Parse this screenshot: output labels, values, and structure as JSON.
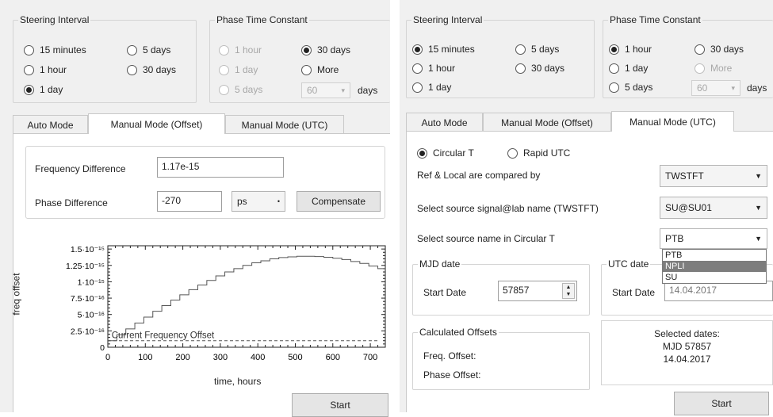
{
  "left": {
    "steering": {
      "legend": "Steering Interval",
      "options": [
        "15 minutes",
        "5 days",
        "1 hour",
        "30 days",
        "1 day"
      ],
      "selected": "1 day"
    },
    "phase": {
      "legend": "Phase Time Constant",
      "options": [
        "1 hour",
        "30 days",
        "1 day",
        "More",
        "5 days"
      ],
      "selected": "30 days",
      "more_value": "60",
      "more_unit": "days"
    },
    "tabs": [
      "Auto Mode",
      "Manual Mode (Offset)",
      "Manual Mode (UTC)"
    ],
    "active_tab": "Manual Mode (Offset)",
    "freq_label": "Frequency Difference",
    "freq_value": "1.17e-15",
    "phase_label": "Phase Difference",
    "phase_value": "-270",
    "phase_unit": "ps",
    "compensate_label": "Compensate",
    "start_label": "Start"
  },
  "chart_data": {
    "type": "line",
    "xlabel": "time, hours",
    "ylabel": "freq offset",
    "annotation": "Current Frequency Offset",
    "xlim": [
      0,
      740
    ],
    "ylim": [
      0,
      1.55e-15
    ],
    "x_ticks": [
      "0",
      "100",
      "200",
      "300",
      "400",
      "500",
      "600",
      "700"
    ],
    "x_tick_values": [
      0,
      100,
      200,
      300,
      400,
      500,
      600,
      700
    ],
    "y_ticks": [
      "0",
      "2.5·10⁻¹⁶",
      "5·10⁻¹⁶",
      "7.5·10⁻¹⁶",
      "1·10⁻¹⁵",
      "1.25·10⁻¹⁵",
      "1.5·10⁻¹⁵"
    ],
    "y_tick_values": [
      0,
      2.5e-16,
      5e-16,
      7.5e-16,
      1e-15,
      1.25e-15,
      1.5e-15
    ],
    "series": [
      {
        "style": "step",
        "x": [
          0,
          24,
          48,
          72,
          96,
          120,
          144,
          168,
          192,
          216,
          240,
          264,
          288,
          312,
          336,
          360,
          384,
          408,
          432,
          456,
          480,
          504,
          528,
          552,
          576,
          600,
          624,
          648,
          672,
          696,
          720
        ],
        "values": [
          1e-16,
          1.9e-16,
          2.8e-16,
          3.7e-16,
          4.6e-16,
          5.5e-16,
          6.35e-16,
          7.2e-16,
          8e-16,
          8.8e-16,
          9.5e-16,
          1.02e-15,
          1.09e-15,
          1.15e-15,
          1.2e-15,
          1.25e-15,
          1.29e-15,
          1.32e-15,
          1.35e-15,
          1.37e-15,
          1.38e-15,
          1.39e-15,
          1.39e-15,
          1.385e-15,
          1.375e-15,
          1.36e-15,
          1.34e-15,
          1.31e-15,
          1.28e-15,
          1.24e-15,
          1.2e-15
        ]
      },
      {
        "style": "dashed",
        "x": [
          0,
          720
        ],
        "values": [
          1e-16,
          1e-16
        ]
      }
    ]
  },
  "right": {
    "steering": {
      "legend": "Steering Interval",
      "options": [
        "15 minutes",
        "5 days",
        "1 hour",
        "30 days",
        "1 day"
      ],
      "selected": "15 minutes"
    },
    "phase": {
      "legend": "Phase Time Constant",
      "options": [
        "1 hour",
        "30 days",
        "1 day",
        "More",
        "5 days"
      ],
      "selected": "1 hour",
      "more_value": "60",
      "more_unit": "days"
    },
    "tabs": [
      "Auto Mode",
      "Manual Mode (Offset)",
      "Manual Mode (UTC)"
    ],
    "active_tab": "Manual Mode (UTC)",
    "circular_label": "Circular T",
    "rapid_label": "Rapid UTC",
    "compared_label": "Ref & Local are compared by",
    "compared_value": "TWSTFT",
    "source_lab_label": "Select source signal@lab name (TWSTFT)",
    "source_lab_value": "SU@SU01",
    "source_name_label": "Select source name in Circular T",
    "source_name_value": "PTB",
    "dropdown_options": [
      "PTB",
      "NPLI",
      "SU"
    ],
    "dropdown_highlight": "NPLI",
    "mjd_legend": "MJD date",
    "start_date_label": "Start Date",
    "start_date_value": "57857",
    "utc_legend": "UTC date",
    "utc_start_label": "Start Date",
    "utc_start_value": "14.04.2017",
    "offsets_legend": "Calculated Offsets",
    "freq_offset_label": "Freq. Offset:",
    "phase_offset_label": "Phase Offset:",
    "selected_title": "Selected dates:",
    "selected_mjd": "MJD 57857",
    "selected_date": "14.04.2017",
    "start_label": "Start"
  }
}
